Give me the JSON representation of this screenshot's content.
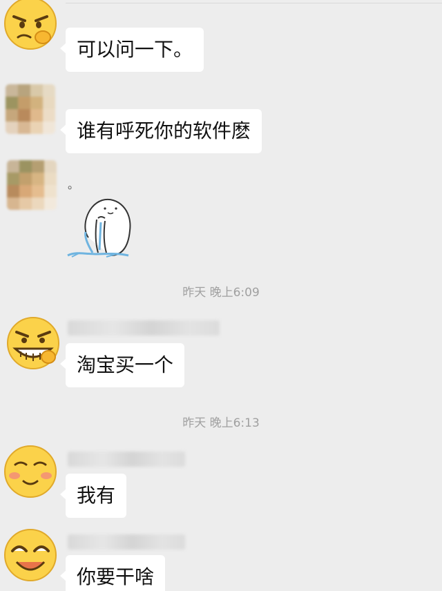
{
  "messages": [
    {
      "text": "可以问一下。",
      "avatar": "smirk-emoji-icon"
    },
    {
      "text": "谁有呼死你的软件麽",
      "avatar": "pixelated-avatar"
    },
    {
      "text": "。",
      "avatar": "pixelated-avatar",
      "sticker": "crying-blob-sticker-icon"
    },
    {
      "text": "淘宝买一个",
      "avatar": "grin-emoji-icon"
    },
    {
      "text": "我有",
      "avatar": "blush-emoji-icon"
    },
    {
      "text": "你要干啥",
      "avatar": "laugh-emoji-icon"
    }
  ],
  "timestamps": [
    "昨天 晚上6:09",
    "昨天 晚上6:13"
  ],
  "colors": {
    "background": "#ededed",
    "bubble": "#ffffff",
    "timestamp_text": "#a0a0a0",
    "emoji_yellow": "#fbd24a"
  }
}
